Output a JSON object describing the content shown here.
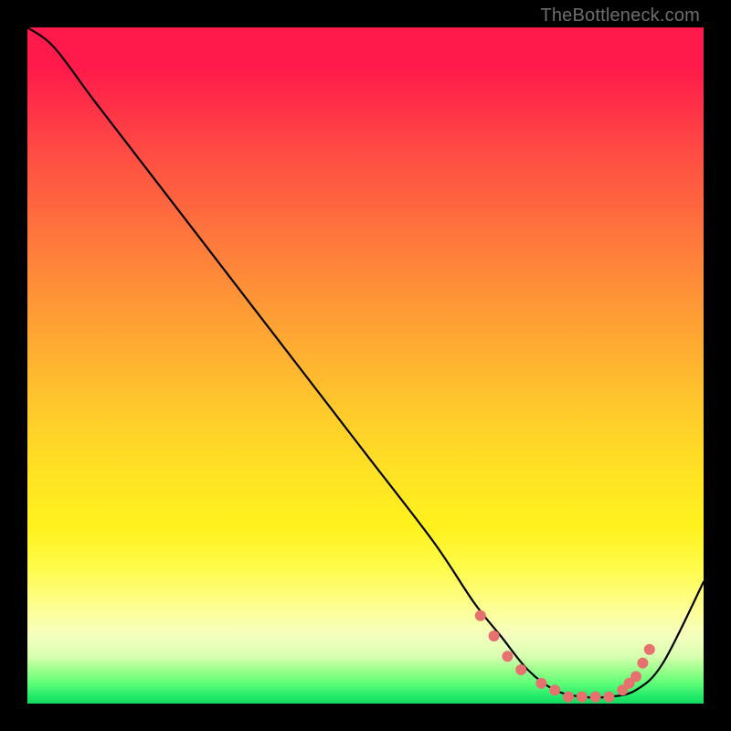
{
  "attribution": "TheBottleneck.com",
  "chart_data": {
    "type": "line",
    "title": "",
    "xlabel": "",
    "ylabel": "",
    "xlim": [
      0,
      100
    ],
    "ylim": [
      0,
      100
    ],
    "series": [
      {
        "name": "curve",
        "x": [
          0,
          4,
          10,
          20,
          30,
          40,
          50,
          60,
          66,
          70,
          74,
          78,
          82,
          86,
          90,
          94,
          100
        ],
        "y": [
          100,
          97,
          89,
          76,
          63,
          50,
          37,
          24,
          15,
          10,
          5,
          2,
          1,
          1,
          2,
          6,
          18
        ]
      }
    ],
    "markers": {
      "name": "dots",
      "x": [
        67,
        69,
        71,
        73,
        76,
        78,
        80,
        82,
        84,
        86,
        88,
        89,
        90,
        91,
        92
      ],
      "y": [
        13,
        10,
        7,
        5,
        3,
        2,
        1,
        1,
        1,
        1,
        2,
        3,
        4,
        6,
        8
      ],
      "color": "#e7716f",
      "radius": 6
    },
    "background": {
      "type": "vertical-gradient",
      "stops": [
        {
          "pos": 0.0,
          "color": "#ff1a4b"
        },
        {
          "pos": 0.5,
          "color": "#ffb030"
        },
        {
          "pos": 0.78,
          "color": "#fff21e"
        },
        {
          "pos": 0.9,
          "color": "#f4ffbf"
        },
        {
          "pos": 1.0,
          "color": "#12d95e"
        }
      ]
    }
  }
}
